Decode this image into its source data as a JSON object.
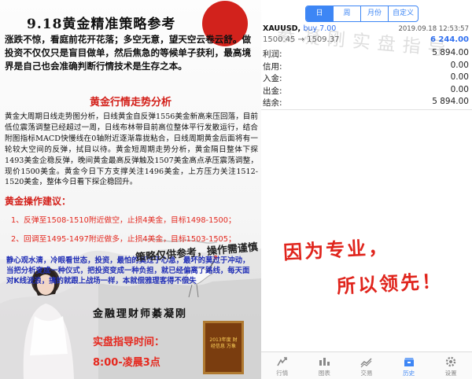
{
  "article": {
    "title": "9.18黄金精准策略参考",
    "intro": "涨跌不惊，看庭前花开花落；多空无意，望天空云卷云舒。做投资不仅仅只是盲目做单，然后焦急的等候单子获利，最高境界是自己也会准确判断行情技术是生存之本。",
    "section_trend": "黄金行情走势分析",
    "analysis": "黄金大周期日线走势图分析，日线黄金自反弹1556美金新高来压回落，目前低位震荡调整已经超过一周，日线布林带目前高位整体平行发散运行，结合附图指标MACD快慢线在0轴附近逐渐靠拢粘合，日线周期黄金后面将有一轮较大空间的反弹，拭目以待。黄金短周期走势分析，黄金隔日整体下探1493美金企稳反弹，晚间黄金最高反弹触及1507美金高点承压震荡调整，现价1500美金。黄金今日下方支撑关注1496美金，上方压力关注1512-1520美金，整体今日看下探企稳回升。",
    "section_advice": "黄金操作建议：",
    "advice": [
      "1、反弹至1508-1510附近做空，止损4美金，目标1498-1500；",
      "2、回调至1495-1497附近做多，止损4美金，目标1503-1505；"
    ],
    "motto": "静心观水清，冷眼看世态，投资，最怕的莫过于心急，最坏的莫过于冲动，当把分析变成一种仪式，把投资变成一种负担，就已经偏离了路线，每天面对K线波浪，搞的就跟上战场一样，本就偿雅理客得不偿失",
    "signature": "策略仅供参考，操作需谨慎",
    "teacher_title": "金融理财师綦凝刚",
    "certificate_text": "2013年度 财经信息 万象",
    "live_label": "实盘指导时间：",
    "live_hours": "8:00-凌晨3点",
    "colors": {
      "accent_red": "#d3201a",
      "sun_red": "#d2221c",
      "motto_blue": "#2230b6"
    }
  },
  "app": {
    "tabs": [
      {
        "label": "日",
        "active": true
      },
      {
        "label": "周",
        "active": false
      },
      {
        "label": "月份",
        "active": false
      },
      {
        "label": "自定义",
        "active": false
      }
    ],
    "trade": {
      "symbol": "XAUUSD,",
      "action": "buy 7.00",
      "datetime": "2019.09.18 12:53:57",
      "prices": "1500.45 → 1509.37",
      "profit": "6 244.00"
    },
    "summary": [
      {
        "label": "利润:",
        "value": "5 894.00"
      },
      {
        "label": "信用:",
        "value": "0.00"
      },
      {
        "label": "入金:",
        "value": "0.00"
      },
      {
        "label": "出金:",
        "value": "0.00"
      },
      {
        "label": "结余:",
        "value": "5 894.00"
      }
    ],
    "watermark": "綦凝刚实盘指导",
    "slogan_line1": "因为专业，",
    "slogan_line2": "所以领先！",
    "nav": [
      {
        "label": "行情",
        "icon": "quotes-icon",
        "active": false
      },
      {
        "label": "图表",
        "icon": "chart-icon",
        "active": false
      },
      {
        "label": "交易",
        "icon": "trade-icon",
        "active": false
      },
      {
        "label": "历史",
        "icon": "history-icon",
        "active": true
      },
      {
        "label": "设置",
        "icon": "settings-icon",
        "active": false
      }
    ],
    "colors": {
      "accent_blue": "#3d86f5",
      "profit_blue": "#2f6ff0",
      "slogan_red": "#e0241c"
    }
  }
}
